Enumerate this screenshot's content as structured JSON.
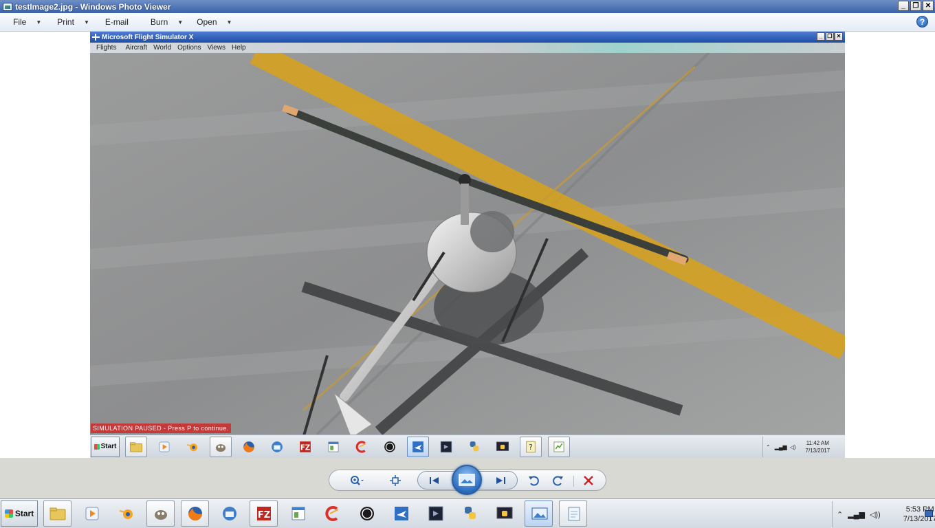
{
  "window": {
    "title": "testImage2.jpg - Windows Photo Viewer",
    "controls": {
      "minimize": "_",
      "maximize": "❐",
      "close": "✕"
    }
  },
  "menu": [
    {
      "label": "File",
      "has_dropdown": true
    },
    {
      "label": "Print",
      "has_dropdown": true
    },
    {
      "label": "E-mail",
      "has_dropdown": false
    },
    {
      "label": "Burn",
      "has_dropdown": true
    },
    {
      "label": "Open",
      "has_dropdown": true
    }
  ],
  "help_label": "?",
  "photo": {
    "fsx_title": "Microsoft Flight Simulator X",
    "fsx_menu": [
      "Flights",
      "Aircraft",
      "World",
      "Options",
      "Views",
      "Help"
    ],
    "paused_text": "SIMULATION PAUSED - Press P to continue.",
    "inner_taskbar": {
      "start_label": "Start",
      "clock_time": "11:42 AM",
      "clock_date": "7/13/2017",
      "icons": [
        "folder-icon",
        "media-player-icon",
        "blender-icon",
        "gimp-icon",
        "firefox-icon",
        "thunderbird-icon",
        "filezilla-icon",
        "window-icon",
        "ccleaner-icon",
        "obs-icon",
        "flight-sim-icon",
        "premiere-icon",
        "python-icon",
        "python-console-icon",
        "help-file-icon",
        "chart-icon"
      ]
    }
  },
  "controls": {
    "zoom": "zoom-icon",
    "fit": "fit-window-icon",
    "previous": "previous-icon",
    "slideshow": "slideshow-icon",
    "next": "next-icon",
    "rotate_ccw": "rotate-counterclockwise-icon",
    "rotate_cw": "rotate-clockwise-icon",
    "delete": "delete-icon"
  },
  "taskbar": {
    "start_label": "Start",
    "clock_time": "5:53 PM",
    "clock_date": "7/13/2017",
    "icons": [
      "folder-icon",
      "media-player-icon",
      "blender-icon",
      "gimp-icon",
      "firefox-icon",
      "thunderbird-icon",
      "filezilla-icon",
      "window-icon",
      "ccleaner-icon",
      "obs-icon",
      "flight-sim-icon",
      "premiere-icon",
      "python-icon",
      "python-console-icon",
      "photo-viewer-icon",
      "notepad-icon"
    ],
    "active_icon": "photo-viewer-icon"
  },
  "colors": {
    "accent": "#2b6cbf",
    "paused_banner": "#c23a3a",
    "runway_line": "#d9a21a"
  }
}
